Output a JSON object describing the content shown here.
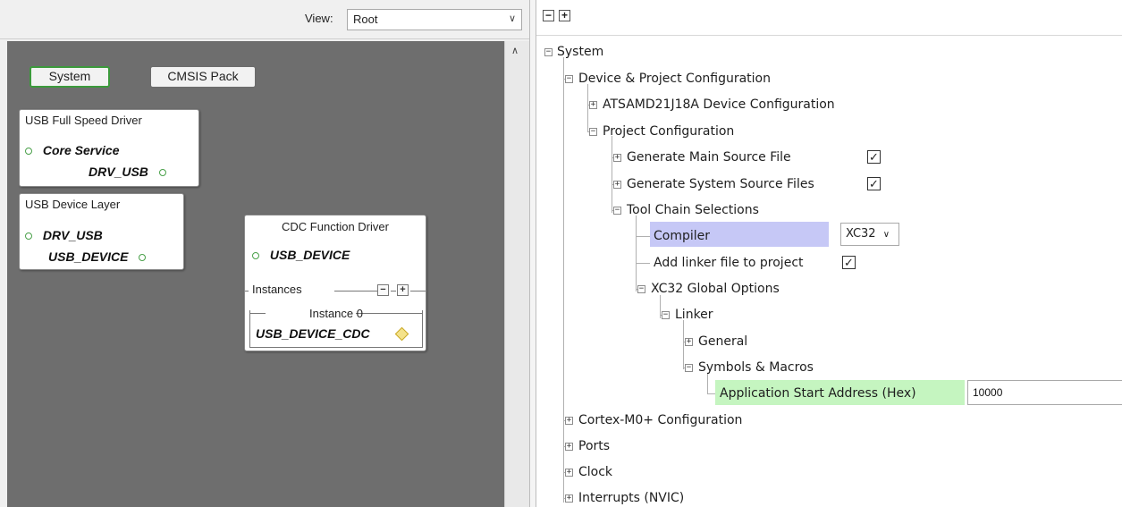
{
  "left": {
    "view_label": "View:",
    "view_value": "Root",
    "buttons": {
      "system": "System",
      "cmsis": "CMSIS Pack"
    },
    "nodes": {
      "usb_full_speed": {
        "title": "USB Full Speed Driver",
        "row1": "Core Service",
        "row2": "DRV_USB"
      },
      "usb_device_layer": {
        "title": "USB Device Layer",
        "row1": "DRV_USB",
        "row2": "USB_DEVICE"
      },
      "cdc": {
        "title": "CDC Function Driver",
        "row1": "USB_DEVICE",
        "instances": "Instances",
        "instance0": "Instance 0",
        "instance0_value": "USB_DEVICE_CDC"
      }
    },
    "colors": {
      "canvas": "#6e6e6e",
      "port_green": "#49a049",
      "diamond": "#f4e28a"
    }
  },
  "right": {
    "toolbar": {
      "collapse": "−",
      "expand": "+"
    },
    "tree": {
      "system": "System",
      "device_project": "Device & Project Configuration",
      "atsamd": "ATSAMD21J18A Device Configuration",
      "project_config": "Project Configuration",
      "gen_main": "Generate Main Source File",
      "gen_system": "Generate System Source Files",
      "toolchain": "Tool Chain Selections",
      "compiler": "Compiler",
      "compiler_value": "XC32",
      "add_linker": "Add linker file to project",
      "xc32_global": "XC32 Global Options",
      "linker": "Linker",
      "general": "General",
      "symbols": "Symbols & Macros",
      "app_start": "Application Start Address (Hex)",
      "app_start_value": "10000",
      "cortex": "Cortex-M0+ Configuration",
      "ports": "Ports",
      "clock": "Clock",
      "interrupts": "Interrupts (NVIC)"
    },
    "checks": {
      "gen_main": "✓",
      "gen_system": "✓",
      "add_linker": "✓"
    },
    "colors": {
      "compiler_highlight": "#c6c8f6",
      "address_highlight": "#c5f5c0"
    }
  }
}
